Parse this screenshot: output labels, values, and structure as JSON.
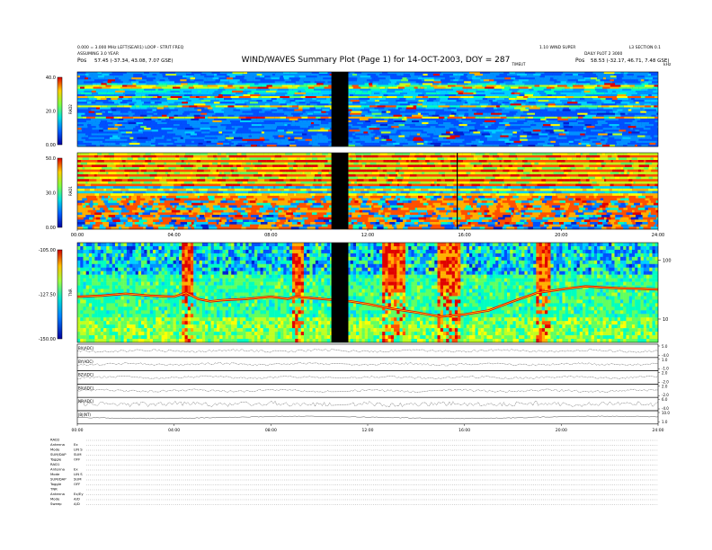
{
  "header": {
    "title": "WIND/WAVES Summary Plot (Page 1) for 14-OCT-2003, DOY = 287",
    "left_line1": "0.000 = 3.000 MHz LEFT(SEAR1) LOOP - STRIT FREQ",
    "left_line2": "ASSUMING 3.0 YEAR",
    "left_pos_label": "Pos",
    "left_pos_value": "57.45 (-37.34, 43.08, 7.07 GSE)",
    "center_label": "TIMEUT",
    "right_line1": "1.10 WIND SUPER",
    "right_line2": "L3 SECTION 0.1",
    "right_line3": "DAILY PLOT 2 3000",
    "right_pos_label": "Pos",
    "right_pos_value": "58.53 (-32.17, 46.71, 7.48 GSE)",
    "khz_label": "kHz"
  },
  "chart_data": [
    {
      "type": "heatmap",
      "name": "RAD2",
      "colorbar_ticks": [
        "40.0",
        "20.0",
        "0.00"
      ],
      "x_range_hours": [
        0,
        24
      ],
      "data_gap_hours": [
        10.5,
        11.2
      ]
    },
    {
      "type": "heatmap",
      "name": "RAD1",
      "colorbar_ticks": [
        "50.0",
        "30.0",
        "0.00"
      ],
      "x_tick_labels": [
        "00:00",
        "04:00",
        "08:00",
        "12:00",
        "16:00",
        "20:00",
        "24:00"
      ],
      "x_range_hours": [
        0,
        24
      ],
      "data_gap_hours": [
        10.5,
        11.2
      ]
    },
    {
      "type": "heatmap",
      "name": "TNR",
      "colorbar_ticks": [
        "-105.00",
        "-127.50",
        "-150.00"
      ],
      "right_axis_ticks": [
        "100",
        "10"
      ],
      "x_range_hours": [
        0,
        24
      ],
      "data_gap_hours": [
        10.5,
        11.2
      ],
      "plasma_line_khz": [
        [
          0,
          24
        ],
        [
          1,
          25
        ],
        [
          2,
          27
        ],
        [
          3,
          25
        ],
        [
          4,
          24
        ],
        [
          4.5,
          28
        ],
        [
          5,
          22
        ],
        [
          5.5,
          20
        ],
        [
          6,
          21
        ],
        [
          7,
          22
        ],
        [
          8,
          24
        ],
        [
          8.7,
          22
        ],
        [
          9,
          24
        ],
        [
          11.3,
          20
        ],
        [
          12,
          18
        ],
        [
          13,
          15
        ],
        [
          14,
          13
        ],
        [
          15,
          11
        ],
        [
          16,
          12
        ],
        [
          17,
          14
        ],
        [
          18,
          20
        ],
        [
          19,
          28
        ],
        [
          20,
          32
        ],
        [
          21,
          36
        ],
        [
          22,
          34
        ],
        [
          23,
          33
        ],
        [
          24,
          32
        ]
      ]
    },
    {
      "type": "line",
      "panels": [
        {
          "label": "BX(ADC)",
          "right_ticks": [
            "5.0",
            "-4.0"
          ]
        },
        {
          "label": "BY(ADC)",
          "right_ticks": [
            "1.0",
            "-1.0"
          ]
        },
        {
          "label": "BZ(ADC)",
          "right_ticks": [
            "2.0",
            "-2.0"
          ]
        },
        {
          "label": "BX(ADC)",
          "right_ticks": [
            "2.0",
            "-2.0"
          ]
        },
        {
          "label": "NP(ADC)",
          "right_ticks": [
            "6.0",
            "-4.0"
          ]
        },
        {
          "label": "|B|(NT)",
          "right_ticks": [
            "10.0",
            "1.0"
          ]
        }
      ],
      "x_tick_labels": [
        "00:00",
        "04:00",
        "08:00",
        "12:00",
        "16:00",
        "20:00",
        "24:00"
      ],
      "x_range_hours": [
        0,
        24
      ]
    }
  ],
  "config": {
    "rows": [
      {
        "key": "RAD2",
        "val": ""
      },
      {
        "key": "Antenna",
        "val": "Ex"
      },
      {
        "key": "Mode",
        "val": "LIN S"
      },
      {
        "key": "SUM/DAP",
        "val": "SUM"
      },
      {
        "key": "Toggle",
        "val": "OFF"
      },
      {
        "key": "RAD1",
        "val": ""
      },
      {
        "key": "Antenna",
        "val": "Ex"
      },
      {
        "key": "Mode",
        "val": "LIN S"
      },
      {
        "key": "SUM/DAP",
        "val": "SUM"
      },
      {
        "key": "Toggle",
        "val": "OFF"
      },
      {
        "key": "TNR",
        "val": ""
      },
      {
        "key": "Antenna",
        "val": "Ex/Ey"
      },
      {
        "key": "Mode",
        "val": "A/D"
      },
      {
        "key": "Sweep",
        "val": "A/D"
      }
    ]
  }
}
